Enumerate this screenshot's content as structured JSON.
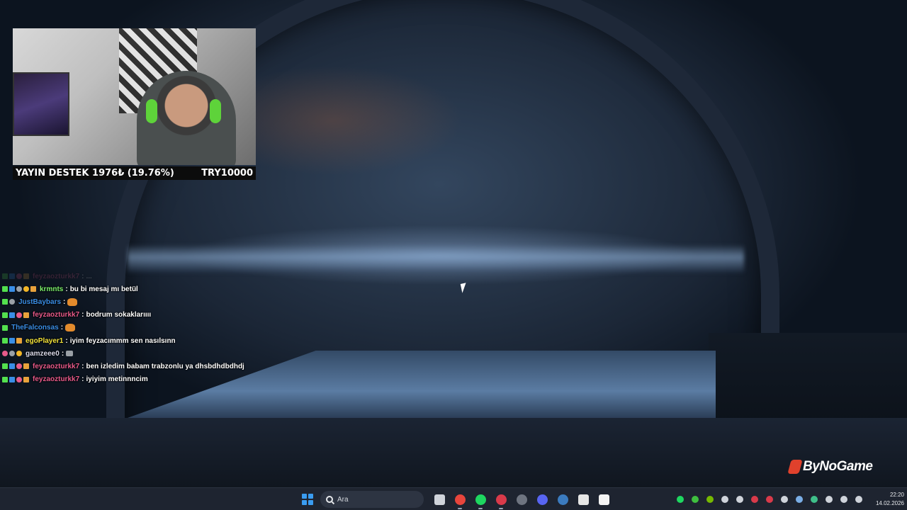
{
  "webcam": {
    "donate_label": "YAYIN DESTEK 1976₺ (19.76%)",
    "donate_goal": "TRY10000",
    "donate_progress_percent": 19.76
  },
  "chat": {
    "faded_line": {
      "user": "feyzaozturkk7",
      "message": "..."
    },
    "lines": [
      {
        "user": "krmnts",
        "user_color": "#7cf06b",
        "message": "bu bi mesaj mı betül",
        "badges": [
          "green",
          "blue",
          "grey",
          "gold",
          "sub"
        ]
      },
      {
        "user": "JustBaybars",
        "user_color": "#3a8ee6",
        "message": "",
        "emote": "cat-emote",
        "badges": [
          "green",
          "grey"
        ]
      },
      {
        "user": "feyzaozturkk7",
        "user_color": "#e85a8a",
        "message": "bodrum sokaklarıııı",
        "badges": [
          "green",
          "blue",
          "pink",
          "sub"
        ]
      },
      {
        "user": "TheFalconsas",
        "user_color": "#3a8ee6",
        "message": "",
        "emote": "cat-emote",
        "badges": [
          "green"
        ]
      },
      {
        "user": "egoPlayer1",
        "user_color": "#f2e23a",
        "message": "iyim feyzacımmm sen nasılsınn",
        "badges": [
          "green",
          "blue",
          "sub"
        ]
      },
      {
        "user": "gamzeee0",
        "user_color": "#d8d8e8",
        "message": "",
        "emote": "small-emote",
        "badges": [
          "pink",
          "grey",
          "gold"
        ]
      },
      {
        "user": "feyzaozturkk7",
        "user_color": "#e85a8a",
        "message": "ben izledim babam trabzonlu ya dhsbdhdbdhdj",
        "badges": [
          "green",
          "blue",
          "pink",
          "sub"
        ]
      },
      {
        "user": "feyzaozturkk7",
        "user_color": "#e85a8a",
        "message": "iyiyim metinnncim",
        "badges": [
          "green",
          "blue",
          "pink",
          "sub"
        ]
      }
    ]
  },
  "sponsor": {
    "name": "ByNoGame",
    "accent": "#e0412c"
  },
  "taskbar": {
    "search_placeholder": "Ara",
    "apps": [
      {
        "name": "task-view-icon",
        "color": "#cfd3da"
      },
      {
        "name": "chrome-icon",
        "color": "#e8453c"
      },
      {
        "name": "spotify-icon",
        "color": "#1ed760"
      },
      {
        "name": "red-app-icon",
        "color": "#d93a4a"
      },
      {
        "name": "obs-icon",
        "color": "#6e7480"
      },
      {
        "name": "discord-icon",
        "color": "#5865f2"
      },
      {
        "name": "steam-icon",
        "color": "#3b7bbf"
      },
      {
        "name": "epic-games-icon",
        "color": "#e6e6e6"
      },
      {
        "name": "capcut-icon",
        "color": "#f4f4f4"
      }
    ],
    "tray": [
      {
        "name": "spotify-tray-icon",
        "color": "#1ed760"
      },
      {
        "name": "xbox-tray-icon",
        "color": "#3fbf3f"
      },
      {
        "name": "nvidia-tray-icon",
        "color": "#76b900"
      },
      {
        "name": "arrow-tray-icon",
        "color": "#cfd3da"
      },
      {
        "name": "settings-tray-icon",
        "color": "#cfd3da"
      },
      {
        "name": "download-tray-icon",
        "color": "#d93a4a"
      },
      {
        "name": "app-tray-icon",
        "color": "#d93a4a"
      },
      {
        "name": "gear-tray-icon",
        "color": "#cfd3da"
      },
      {
        "name": "steam-tray-icon",
        "color": "#7aaee6"
      },
      {
        "name": "shield-tray-icon",
        "color": "#3fbf8a"
      },
      {
        "name": "mic-tray-icon",
        "color": "#cfd3da"
      },
      {
        "name": "network-tray-icon",
        "color": "#cfd3da"
      },
      {
        "name": "volume-tray-icon",
        "color": "#cfd3da"
      }
    ],
    "time": "22:20",
    "date": "14.02.2026"
  }
}
